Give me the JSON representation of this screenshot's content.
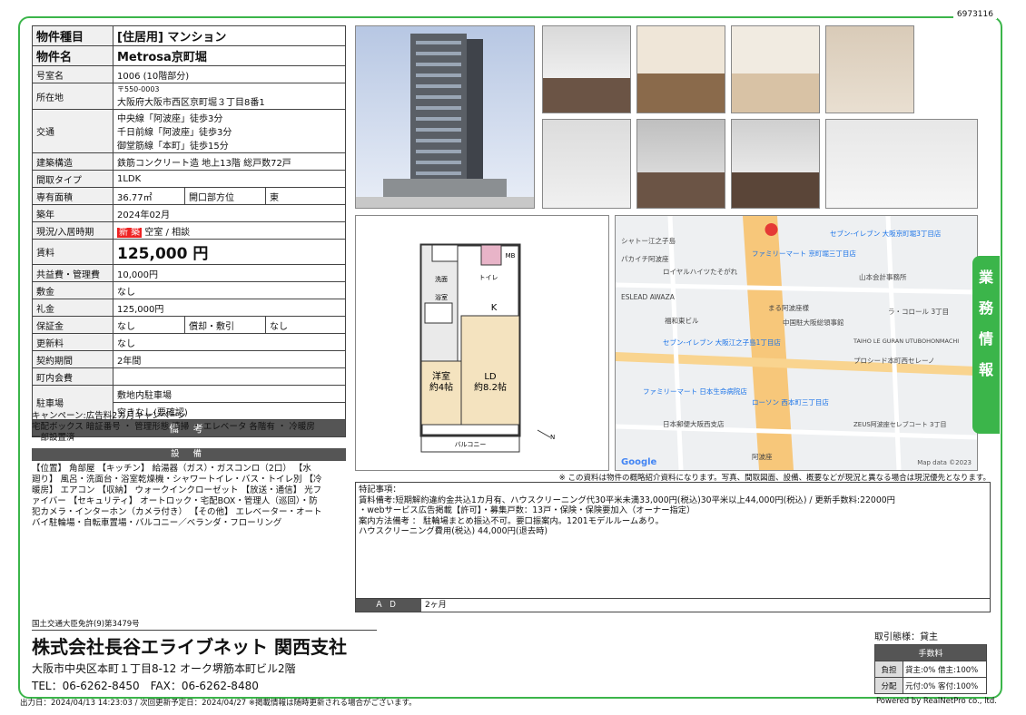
{
  "doc_id": "6973116",
  "spec": {
    "type_label": "物件種目",
    "type_value": "[住居用] マンション",
    "name_label": "物件名",
    "name_value": "Metrosa京町堀",
    "room_label": "号室名",
    "room_value": "1006 (10階部分)",
    "addr_label": "所在地",
    "zip": "〒550-0003",
    "addr_value": "大阪府大阪市西区京町堀３丁目8番1",
    "access_label": "交通",
    "access": [
      "中央線「阿波座」徒歩3分",
      "千日前線「阿波座」徒歩3分",
      "御堂筋線「本町」徒歩15分"
    ],
    "struct_label": "建築構造",
    "struct_value": "鉄筋コンクリート造 地上13階 総戸数72戸",
    "layout_label": "間取タイプ",
    "layout_value": "1LDK",
    "area_label": "専有面積",
    "area_value": "36.77㎡",
    "opening_label": "開口部方位",
    "opening_value": "東",
    "built_label": "築年",
    "built_value": "2024年02月",
    "status_label": "現況/入居時期",
    "status_new": "新 築",
    "status_value": "空室 / 相談",
    "rent_label": "賃料",
    "rent_value": "125,000 円",
    "fee_label": "共益費・管理費",
    "fee_value": "10,000円",
    "deposit_label": "敷金",
    "deposit_value": "なし",
    "keymoney_label": "礼金",
    "keymoney_value": "125,000円",
    "guarantee_label": "保証金",
    "guarantee_value": "なし",
    "amort_label": "償却・敷引",
    "amort_value": "なし",
    "renewal_label": "更新料",
    "renewal_value": "なし",
    "period_label": "契約期間",
    "period_value": "2年間",
    "town_label": "町内会費",
    "town_value": "",
    "parking_label": "駐車場",
    "parking_value1": "敷地内駐車場",
    "parking_value2": "空きなし(要確認)"
  },
  "remarks_section": {
    "title": "備 考",
    "lines": [
      "キャンペーン:広告料2カ月キャンペーン",
      "宅配ボックス 暗証番号 ・ 管理形態 清掃 ・ エレベータ 各階有 ・ 冷暖房",
      "一部設置済"
    ]
  },
  "equipment_section": {
    "title": "設 備",
    "lines": [
      "【位置】 角部屋 【キッチン】 給湯器（ガス）・ガスコンロ（2口） 【水",
      "廻り】 風呂・洗面台・浴室乾燥機・シャワートイレ・バス・トイレ別 【冷",
      "暖房】 エアコン 【収納】 ウォークインクローゼット 【放送・通信】 光フ",
      "ァイバー 【セキュリティ】 オートロック・宅配BOX・管理人（巡回）・防",
      "犯カメラ・インターホン（カメラ付き） 【その他】 エレベーター・オート",
      "バイ駐輪場・自転車置場・バルコニー／ベランダ・フローリング"
    ]
  },
  "floorplan": {
    "labels": {
      "western": "洋室",
      "western_size": "約4帖",
      "ld": "LD",
      "ld_size": "約8.2帖",
      "kitchen": "K",
      "balcony": "バルコニー",
      "bath": "浴室",
      "wash": "洗面",
      "toilet": "トイレ",
      "mb": "MB",
      "north": "N"
    }
  },
  "map": {
    "labels": [
      "シャトー江之子島",
      "セブン-イレブン 大阪京町堀3丁目店",
      "ファミリーマート 京町堀三丁目店",
      "パカイチ阿波座",
      "ロイヤルハイツたそがれ",
      "山本会計事務所",
      "ESLEAD AWAZA",
      "福和東ビル",
      "まる阿波座様",
      "中国駐大阪総領事館",
      "ラ・コロール 3丁目",
      "セブン-イレブン 大阪江之子島1丁目店",
      "TAIHO LE GURAN UTUBOHONMACHI",
      "プロシード本町西セレーノ",
      "ファミリーマート 日本生命病院店",
      "ローソン 西本町三丁目店",
      "日本郵便大阪西支店",
      "阿波座",
      "ZEUS阿波座セレブコート 3丁目"
    ],
    "attribution": "Map data ©2023",
    "logo": "Google"
  },
  "notice": "※ この資料は物件の概略紹介資料になります。写真、間取図面、設備、概要などが現況と異なる場合は現況優先となります。",
  "special_remarks": {
    "lines": [
      "特記事項：",
      "賃料備考:短期解約違約金共込1カ月有、ハウスクリーニング代30平米未満33,000円(税込)30平米以上44,000円(税込) / 更新手数料:22000円",
      "・webサービス広告掲載【許可】・募集戸数：13戸・保険・保険要加入（オーナー指定）",
      "案内方法備考 ： 駐輪場まとめ振込不可。要口振案内。1201モデルルームあり。",
      "ハウスクリーニング費用(税込) 44,000円(退去時)"
    ],
    "ad_label": "ＡＤ",
    "ad_value": "2ヶ月"
  },
  "side_tab": [
    "業",
    "務",
    "情",
    "報"
  ],
  "company": {
    "license": "国土交通大臣免許(9)第3479号",
    "name": "株式会社長谷エライブネット 関西支社",
    "address": "大阪市中央区本町１丁目8-12 オーク堺筋本町ビル2階",
    "tel": "TEL：06-6262-8450　FAX：06-6262-8480"
  },
  "terms": {
    "title": "取引態様：貸主",
    "fee_header": "手数料",
    "burden_label": "負担",
    "burden_value": "貸主:0% 借主:100%",
    "split_label": "分配",
    "split_value": "元付:0% 客付:100%"
  },
  "footer": "出力日：2024/04/13 14:23:03 / 次回更新予定日：2024/04/27 ※掲載情報は随時更新される場合がございます。",
  "powered": "Powered by RealNetPro co., ltd."
}
